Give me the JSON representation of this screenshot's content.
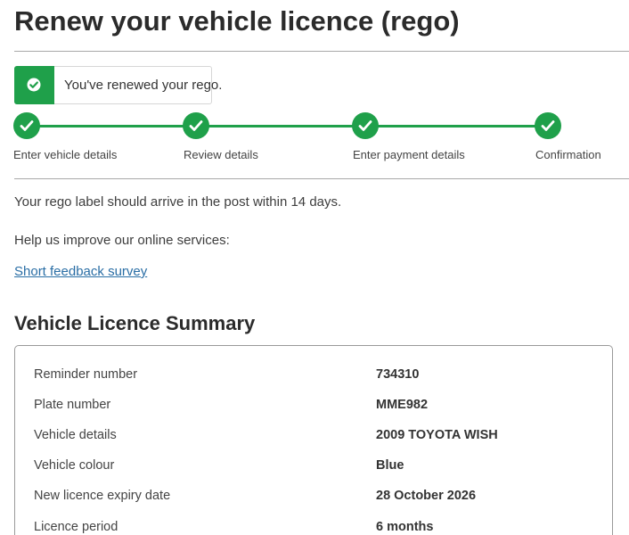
{
  "page": {
    "title": "Renew your vehicle licence (rego)"
  },
  "toast": {
    "message": "You've renewed your rego.",
    "icon": "check-circle-icon",
    "color": "#1fa04a"
  },
  "steps": [
    {
      "label": "Enter vehicle details",
      "status": "complete",
      "icon": "check-icon"
    },
    {
      "label": "Review details",
      "status": "complete",
      "icon": "check-icon"
    },
    {
      "label": "Enter payment details",
      "status": "complete",
      "icon": "check-icon"
    },
    {
      "label": "Confirmation",
      "status": "complete",
      "icon": "check-icon"
    }
  ],
  "content": {
    "arrival_notice": "Your rego label should arrive in the post within 14 days.",
    "improve_prompt": "Help us improve our online services:",
    "feedback_link": "Short feedback survey"
  },
  "summary": {
    "title": "Vehicle Licence Summary",
    "rows": [
      {
        "label": "Reminder number",
        "value": "734310"
      },
      {
        "label": "Plate number",
        "value": "MME982"
      },
      {
        "label": "Vehicle details",
        "value": "2009 TOYOTA WISH"
      },
      {
        "label": "Vehicle colour",
        "value": "Blue"
      },
      {
        "label": "New licence expiry date",
        "value": "28 October 2026"
      },
      {
        "label": "Licence period",
        "value": "6 months"
      }
    ]
  }
}
